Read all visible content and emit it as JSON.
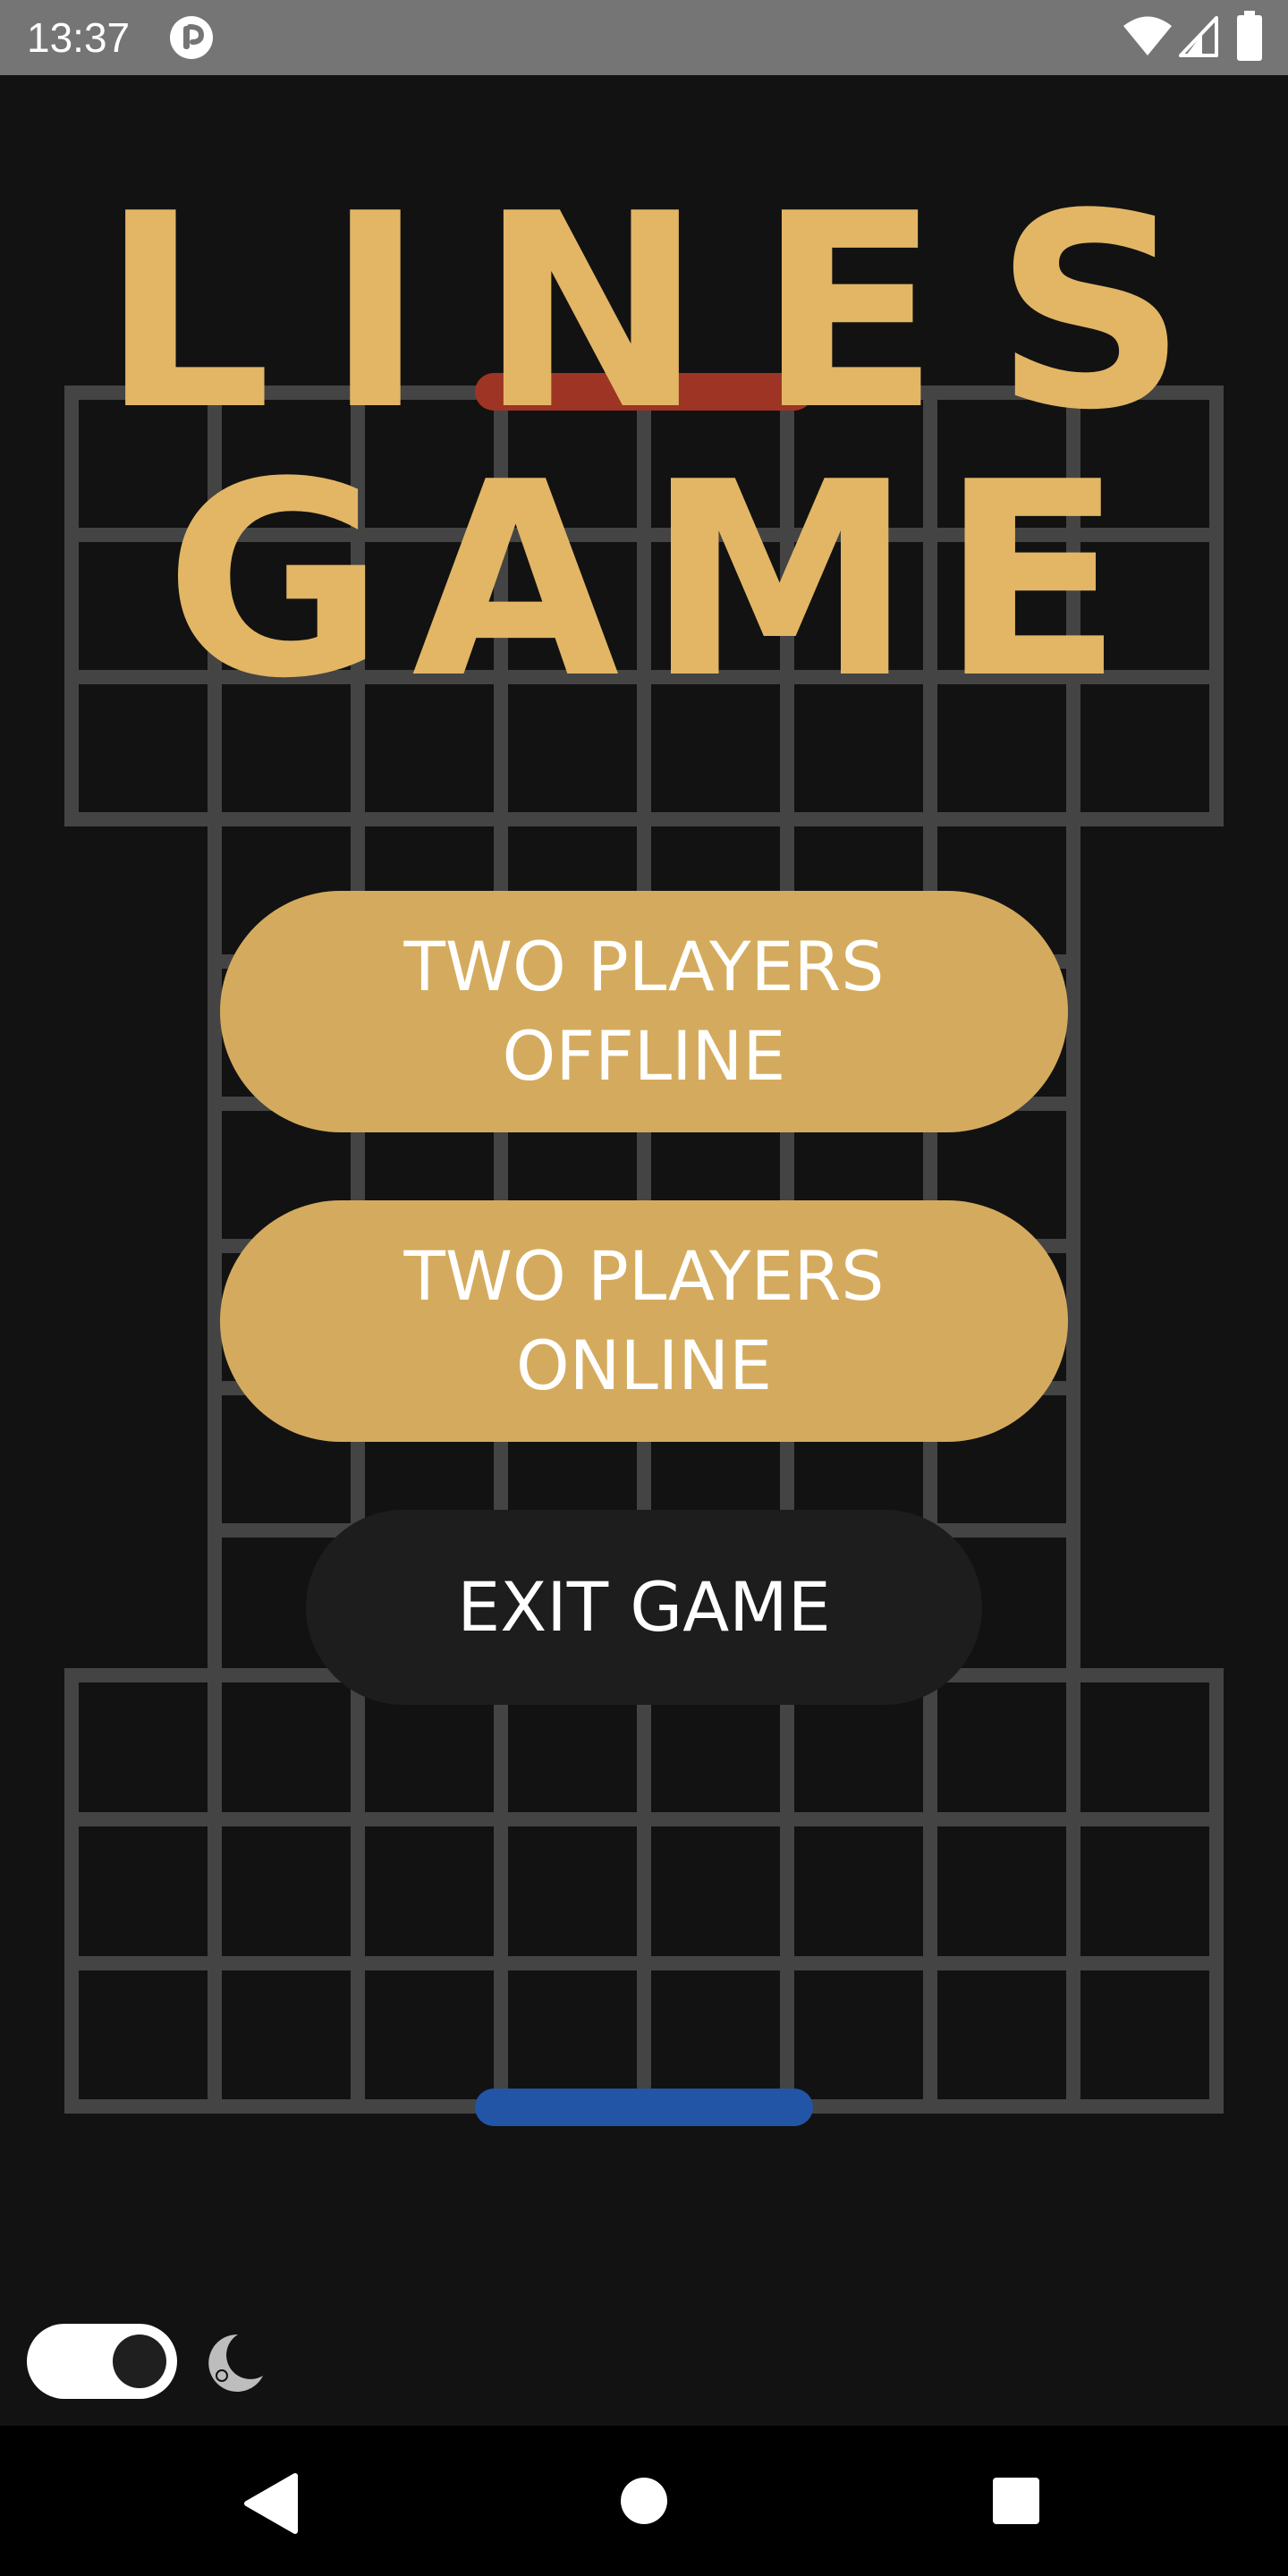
{
  "status_bar": {
    "time": "13:37",
    "icons": [
      "app-notification-icon",
      "wifi-icon",
      "signal-icon",
      "battery-icon"
    ]
  },
  "title": {
    "line1": "LINES",
    "line2": "GAME"
  },
  "menu": {
    "two_players_offline": {
      "line1": "TWO PLAYERS",
      "line2": "OFFLINE"
    },
    "two_players_online": {
      "line1": "TWO PLAYERS",
      "line2": "ONLINE"
    },
    "exit_game": "EXIT GAME"
  },
  "theme_toggle": {
    "dark_mode": true,
    "icon": "moon-icon"
  },
  "nav_bar": {
    "icons": [
      "back-icon",
      "home-icon",
      "recents-icon"
    ]
  },
  "colors": {
    "background": "#121212",
    "grid_line": "#444444",
    "title": "#e2b665",
    "primary_button": "#d4ab5e",
    "exit_button": "#1d1d1d",
    "top_goal": "#9e3423",
    "bottom_goal": "#2255a6",
    "status_bar": "#757575"
  }
}
